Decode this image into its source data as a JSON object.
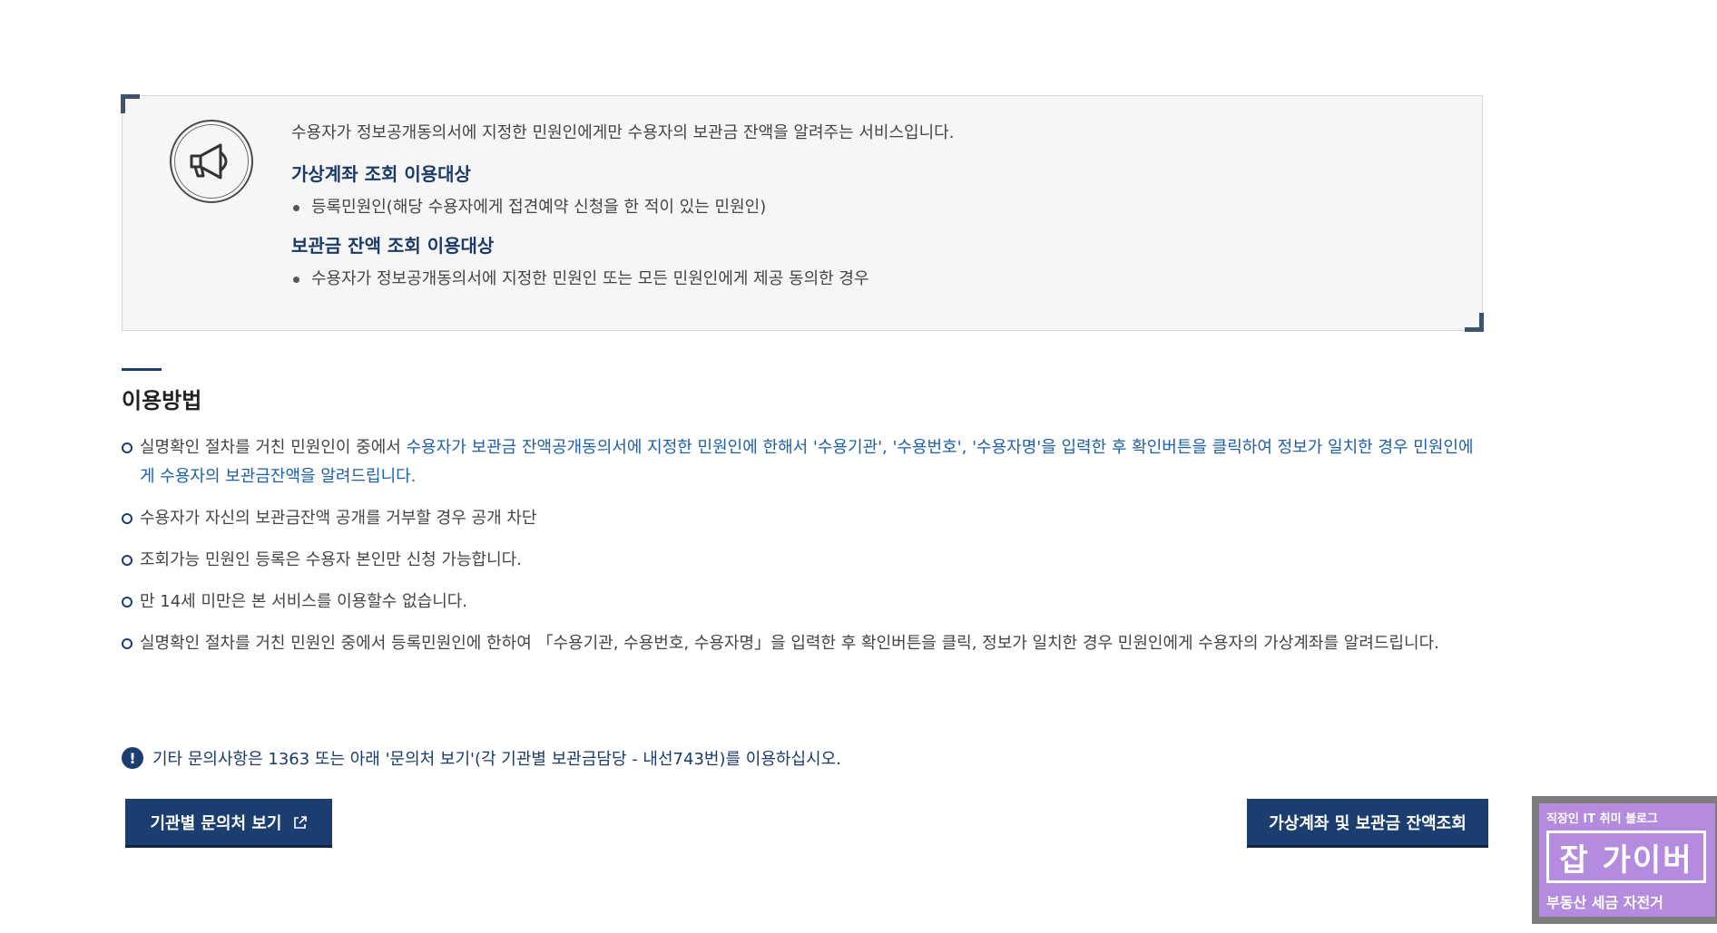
{
  "notice": {
    "intro": "수용자가 정보공개동의서에 지정한 민원인에게만 수용자의 보관금 잔액을 알려주는 서비스입니다.",
    "section1_title": "가상계좌 조회 이용대상",
    "section1_item": "등록민원인(해당 수용자에게 접견예약 신청을 한 적이 있는 민원인)",
    "section2_title": "보관금 잔액 조회 이용대상",
    "section2_item": "수용자가 정보공개동의서에 지정한 민원인 또는 모든 민원인에게 제공 동의한 경우"
  },
  "usage": {
    "title": "이용방법",
    "item1_pre": "실명확인 절차를 거친 민원인이 중에서 ",
    "item1_hl": "수용자가 보관금 잔액공개동의서에 지정한 민원인에 한해서 '수용기관', '수용번호', '수용자명'을 입력한 후 확인버튼을 클릭하여 정보가 일치한 경우 민원인에게 수용자의 보관금잔액을 알려드립니다.",
    "item2": "수용자가 자신의 보관금잔액 공개를 거부할 경우 공개 차단",
    "item3": "조회가능 민원인 등록은 수용자 본인만 신청 가능합니다.",
    "item4": "만 14세 미만은 본 서비스를 이용할수 없습니다.",
    "item5": "실명확인 절차를 거친 민원인 중에서 등록민원인에 한하여 「수용기관, 수용번호, 수용자명」을 입력한 후 확인버튼을 클릭, 정보가 일치한 경우 민원인에게 수용자의 가상계좌를 알려드립니다."
  },
  "info": {
    "icon": "!",
    "text": "기타 문의사항은 1363 또는 아래 '문의처 보기'(각 기관별 보관금담당 - 내선743번)를 이용하십시오."
  },
  "buttons": {
    "contact_label": "기관별 문의처 보기",
    "inquiry_label": "가상계좌 및 보관금 잔액조회"
  },
  "badge": {
    "top": "직장인 IT 취미 블로그",
    "mid": "잡 가이버",
    "bottom": "부동산 세금 자전거"
  },
  "colors": {
    "primary": "#1c3d70",
    "highlight": "#1d5fa8",
    "badge": "#b58be0"
  }
}
